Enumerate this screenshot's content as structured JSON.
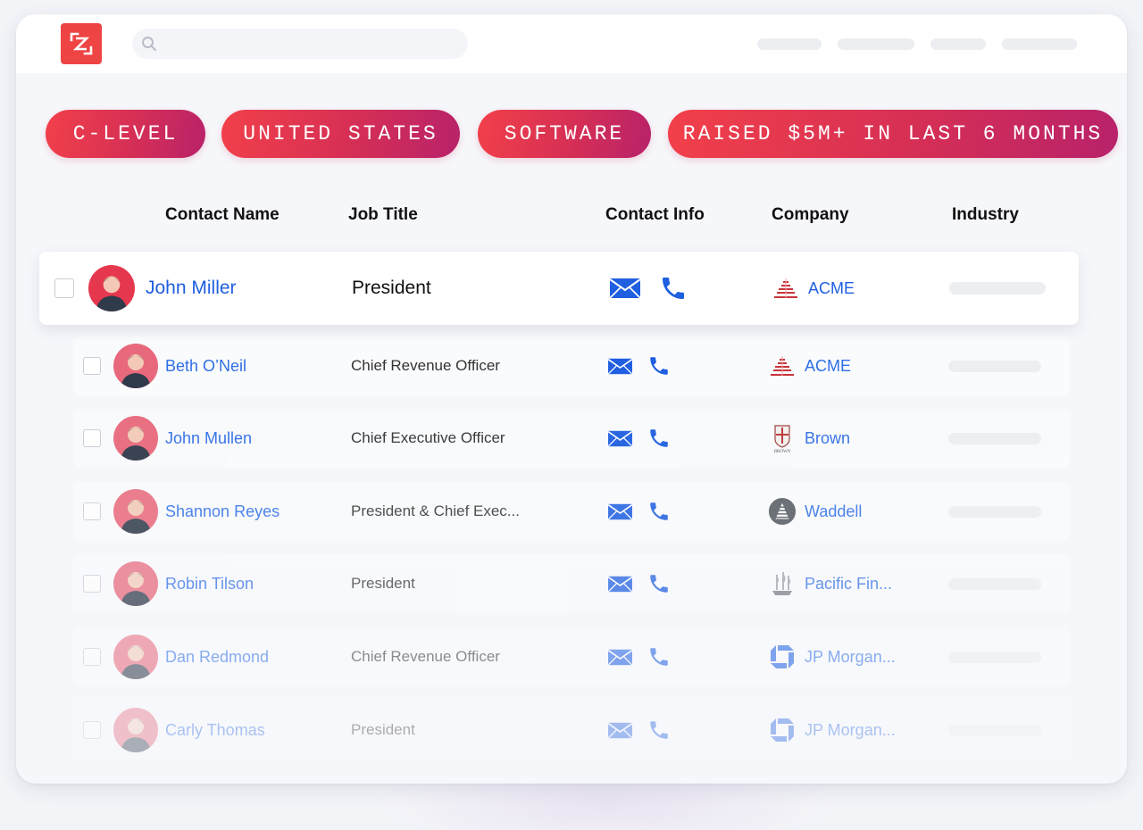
{
  "app": {
    "logo_letter": "Z",
    "logo_color": "#ef4444"
  },
  "search": {
    "placeholder": ""
  },
  "filters": [
    {
      "label": "C-LEVEL"
    },
    {
      "label": "UNITED STATES"
    },
    {
      "label": "SOFTWARE"
    },
    {
      "label": "RAISED $5M+ IN LAST 6 MONTHS"
    }
  ],
  "table": {
    "headers": {
      "contact_name": "Contact Name",
      "job_title": "Job Title",
      "contact_info": "Contact Info",
      "company": "Company",
      "industry": "Industry"
    },
    "rows": [
      {
        "name": "John Miller",
        "title": "President",
        "company": "ACME",
        "company_logo": "acme-logo",
        "avatar_color": "#e5384f",
        "opacity": 1.0
      },
      {
        "name": "Beth O’Neil",
        "title": "Chief Revenue Officer",
        "company": "ACME",
        "company_logo": "acme-logo",
        "avatar_color": "#e8697c",
        "opacity": 1.0
      },
      {
        "name": "John Mullen",
        "title": "Chief Executive Officer",
        "company": "Brown",
        "company_logo": "brown-logo",
        "avatar_color": "#e8697c",
        "opacity": 0.95
      },
      {
        "name": "Shannon Reyes",
        "title": "President & Chief Exec...",
        "company": "Waddell",
        "company_logo": "waddell-logo",
        "avatar_color": "#e8697c",
        "opacity": 0.85
      },
      {
        "name": "Robin Tilson",
        "title": "President",
        "company": "Pacific Fin...",
        "company_logo": "ship-logo",
        "avatar_color": "#e8697c",
        "opacity": 0.72
      },
      {
        "name": "Dan Redmond",
        "title": "Chief Revenue Officer",
        "company": "JP Morgan...",
        "company_logo": "chase-logo",
        "avatar_color": "#e8697c",
        "opacity": 0.55
      },
      {
        "name": "Carly Thomas",
        "title": "President",
        "company": "JP Morgan...",
        "company_logo": "chase-logo",
        "avatar_color": "#e8697c",
        "opacity": 0.38
      }
    ]
  },
  "colors": {
    "accent_blue": "#1f5fe0",
    "chip_gradient_start": "#f2404a",
    "chip_gradient_end": "#b8226a"
  }
}
